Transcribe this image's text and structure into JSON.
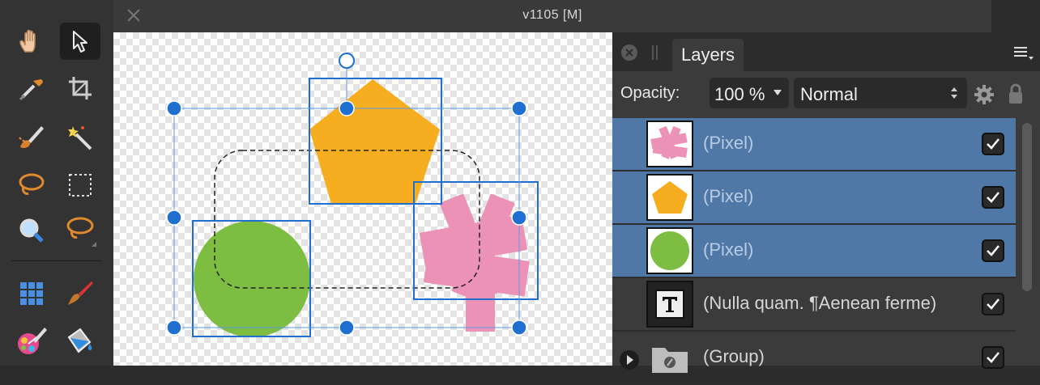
{
  "window": {
    "title": "v1105   [M]"
  },
  "tools": [
    {
      "name": "hand-tool"
    },
    {
      "name": "move-tool"
    },
    {
      "name": "color-picker-tool"
    },
    {
      "name": "crop-tool"
    },
    {
      "name": "selection-brush-tool"
    },
    {
      "name": "magic-wand-tool"
    },
    {
      "name": "freehand-selection-tool"
    },
    {
      "name": "marquee-tool"
    },
    {
      "name": "zoom-tool"
    },
    {
      "name": "lasso-tool"
    },
    {
      "name": "mesh-warp-tool"
    },
    {
      "name": "paint-brush-tool"
    },
    {
      "name": "color-replacement-tool"
    },
    {
      "name": "flood-fill-tool"
    }
  ],
  "panel": {
    "tab": "Layers",
    "opacity_label": "Opacity:",
    "opacity_value": "100 %",
    "blend_mode": "Normal",
    "layers": [
      {
        "name": "(Pixel)",
        "thumb": "pink-shape",
        "selected": true,
        "visible": true
      },
      {
        "name": "(Pixel)",
        "thumb": "orange-pentagon",
        "selected": true,
        "visible": true
      },
      {
        "name": "(Pixel)",
        "thumb": "green-circle",
        "selected": true,
        "visible": true
      },
      {
        "name": "(Nulla quam. ¶Aenean ferme)",
        "thumb": "text-icon",
        "selected": false,
        "visible": true
      },
      {
        "name": "(Group)",
        "thumb": "folder-icon",
        "selected": false,
        "visible": true
      }
    ]
  },
  "colors": {
    "selection": "#4f78a6",
    "accent": "#1f6fd0",
    "pentagon": "#f6ad1f",
    "circle": "#7cbd42",
    "pink": "#ec92b6"
  }
}
